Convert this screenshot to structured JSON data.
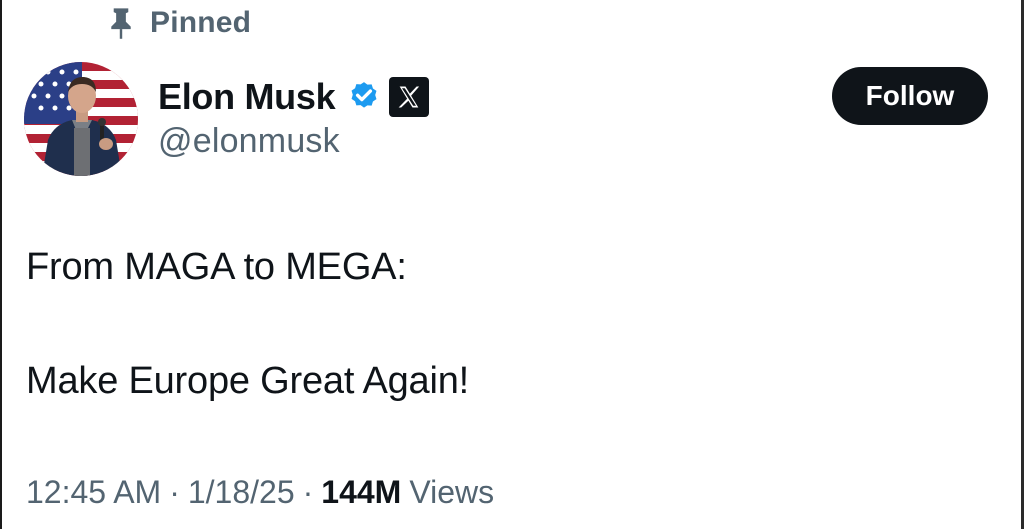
{
  "pinned": {
    "label": "Pinned",
    "icon": "pin-icon"
  },
  "author": {
    "display_name": "Elon Musk",
    "handle": "@elonmusk",
    "verified_icon": "verified-badge-icon",
    "affiliate_icon": "x-logo-icon",
    "verified_color": "#1d9bf0"
  },
  "follow_button": {
    "label": "Follow"
  },
  "tweet": {
    "lines": [
      "From MAGA to MEGA:",
      "Make Europe Great Again!"
    ]
  },
  "meta": {
    "time": "12:45 AM",
    "separator": "·",
    "date": "1/18/25",
    "views_count": "144M",
    "views_label": "Views"
  },
  "colors": {
    "text_primary": "#0f1419",
    "text_secondary": "#536471",
    "button_bg": "#0f1419",
    "button_text": "#ffffff"
  }
}
